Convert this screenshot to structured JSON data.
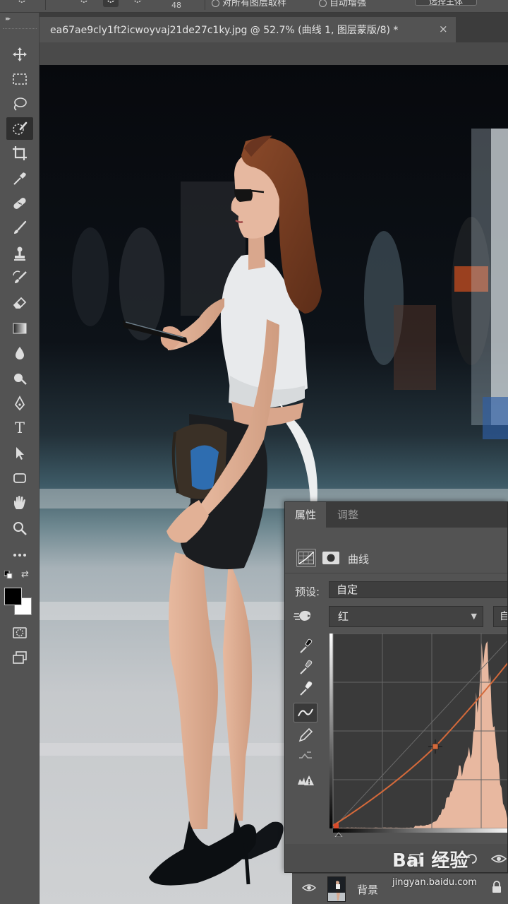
{
  "options_bar": {
    "brush_size": "48",
    "option1_label": "对所有图层取样",
    "option2_label": "自动增强",
    "button_label": "选择主体"
  },
  "toolbar": {
    "tools": [
      "move-tool",
      "marquee-tool",
      "lasso-tool",
      "quick-selection-tool",
      "crop-tool",
      "eyedropper-tool",
      "healing-brush-tool",
      "brush-tool",
      "clone-stamp-tool",
      "history-brush-tool",
      "eraser-tool",
      "gradient-tool",
      "blur-tool",
      "dodge-tool",
      "pen-tool",
      "type-tool",
      "path-selection-tool",
      "rectangle-tool",
      "hand-tool",
      "zoom-tool",
      "more-tools"
    ],
    "active_tool": "quick-selection-tool",
    "type_tool_glyph": "T",
    "foreground_color": "#000000",
    "background_color": "#ffffff"
  },
  "document": {
    "tab_title": "ea67ae9cly1ft2icwoyvaj21de27c1ky.jpg @ 52.7% (曲线 1, 图层蒙版/8) *",
    "close_glyph": "×"
  },
  "properties_panel": {
    "tabs": [
      "属性",
      "调整"
    ],
    "active_tab": "属性",
    "adjustment_kind": "曲线",
    "preset_label": "预设:",
    "preset_value": "自定",
    "channel_value": "红",
    "auto_button": "自",
    "active_curve_tool": "curve-edit-tool",
    "histogram_color": "#e8b8a0",
    "curve_color": "#d4693a"
  },
  "layers": {
    "layer_name": "背景"
  },
  "watermark": {
    "logo": "Bai 经验",
    "url": "jingyan.baidu.com"
  }
}
